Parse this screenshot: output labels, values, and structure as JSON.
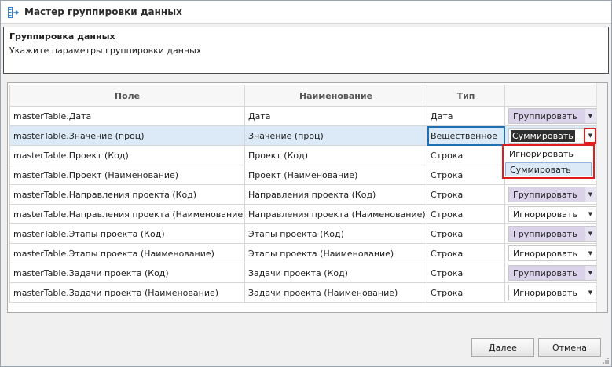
{
  "window": {
    "title": "Мастер группировки данных"
  },
  "header": {
    "title": "Группировка данных",
    "subtitle": "Укажите параметры группировки данных"
  },
  "grid": {
    "columns": [
      "Поле",
      "Наименование",
      "Тип",
      ""
    ],
    "rows": [
      {
        "field": "masterTable.Дата",
        "name": "Дата",
        "type": "Дата",
        "action": "Группировать",
        "style": "group"
      },
      {
        "field": "masterTable.Значение (проц)",
        "name": "Значение (проц)",
        "type": "Вещественное",
        "action": "Суммировать",
        "style": "focused"
      },
      {
        "field": "masterTable.Проект (Код)",
        "name": "Проект (Код)",
        "type": "Строка",
        "action": "",
        "style": "hidden"
      },
      {
        "field": "masterTable.Проект (Наименование)",
        "name": "Проект (Наименование)",
        "type": "Строка",
        "action": "",
        "style": "hidden"
      },
      {
        "field": "masterTable.Направления проекта (Код)",
        "name": "Направления проекта (Код)",
        "type": "Строка",
        "action": "Группировать",
        "style": "group"
      },
      {
        "field": "masterTable.Направления проекта (Наименование)",
        "name": "Направления проекта (Наименование)",
        "type": "Строка",
        "action": "Игнорировать",
        "style": "plain"
      },
      {
        "field": "masterTable.Этапы проекта (Код)",
        "name": "Этапы проекта (Код)",
        "type": "Строка",
        "action": "Группировать",
        "style": "group"
      },
      {
        "field": "masterTable.Этапы проекта (Наименование)",
        "name": "Этапы проекта (Наименование)",
        "type": "Строка",
        "action": "Игнорировать",
        "style": "plain"
      },
      {
        "field": "masterTable.Задачи проекта (Код)",
        "name": "Задачи проекта (Код)",
        "type": "Строка",
        "action": "Группировать",
        "style": "group"
      },
      {
        "field": "masterTable.Задачи проекта (Наименование)",
        "name": "Задачи проекта (Наименование)",
        "type": "Строка",
        "action": "Игнорировать",
        "style": "plain"
      }
    ]
  },
  "dropdown": {
    "options": [
      "Игнорировать",
      "Суммировать"
    ],
    "highlighted": "Суммировать"
  },
  "buttons": {
    "next": "Далее",
    "cancel": "Отмена"
  },
  "icons": {
    "window": "wizard-table-icon",
    "arrow": "dropdown-arrow-icon"
  },
  "colors": {
    "group_bg": "#d9d2e9",
    "selected_row": "#dce9f6",
    "highlight_blue": "#1f6fb3",
    "highlight_red": "#e11d1d"
  }
}
